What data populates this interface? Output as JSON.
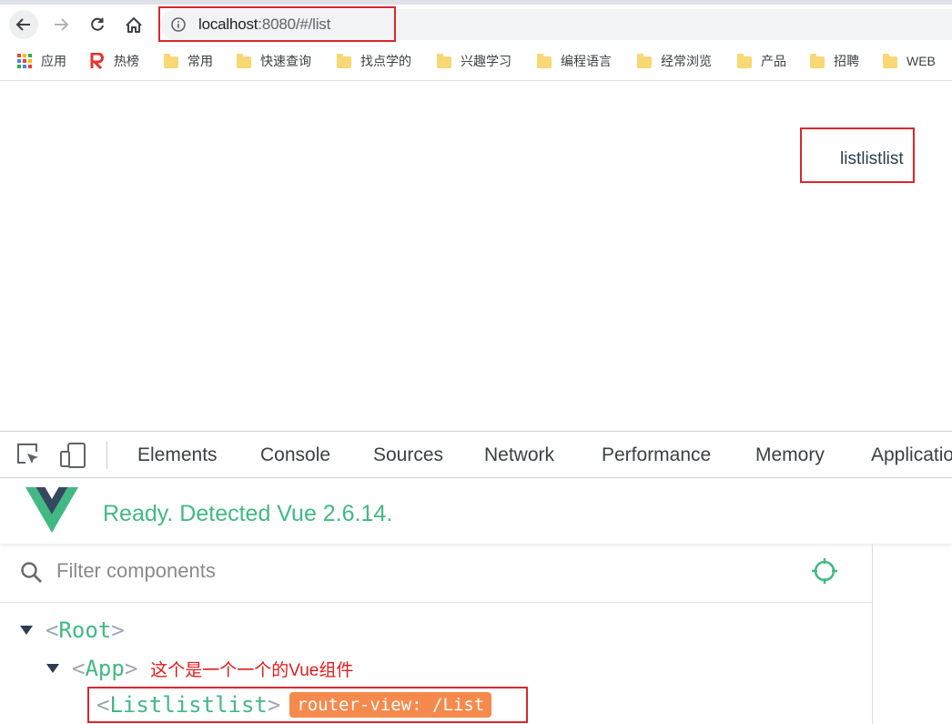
{
  "browser": {
    "url_host": "localhost",
    "url_rest": ":8080/#/list",
    "bookmarks": [
      {
        "label": "应用",
        "icon": "apps-grid-icon"
      },
      {
        "label": "热榜",
        "icon": "r-logo-icon"
      },
      {
        "label": "常用",
        "icon": "folder-icon"
      },
      {
        "label": "快速查询",
        "icon": "folder-icon"
      },
      {
        "label": "找点学的",
        "icon": "folder-icon"
      },
      {
        "label": "兴趣学习",
        "icon": "folder-icon"
      },
      {
        "label": "编程语言",
        "icon": "folder-icon"
      },
      {
        "label": "经常浏览",
        "icon": "folder-icon"
      },
      {
        "label": "产品",
        "icon": "folder-icon"
      },
      {
        "label": "招聘",
        "icon": "folder-icon"
      },
      {
        "label": "WEB",
        "icon": "folder-icon"
      }
    ]
  },
  "page": {
    "content_text": "listlistlist"
  },
  "devtools": {
    "tabs": [
      "Elements",
      "Console",
      "Sources",
      "Network",
      "Performance",
      "Memory",
      "Applicatio"
    ],
    "vue": {
      "status": "Ready. Detected Vue 2.6.14.",
      "filter_placeholder": "Filter components",
      "tree": {
        "root": "Root",
        "app": "App",
        "app_annotation": "这个是一个一个的Vue组件",
        "child": "Listlistlist",
        "child_badge": "router-view: /List"
      }
    }
  },
  "colors": {
    "vue_green": "#42b983",
    "highlight_red": "#d9272e",
    "badge_orange": "#f6894c"
  }
}
